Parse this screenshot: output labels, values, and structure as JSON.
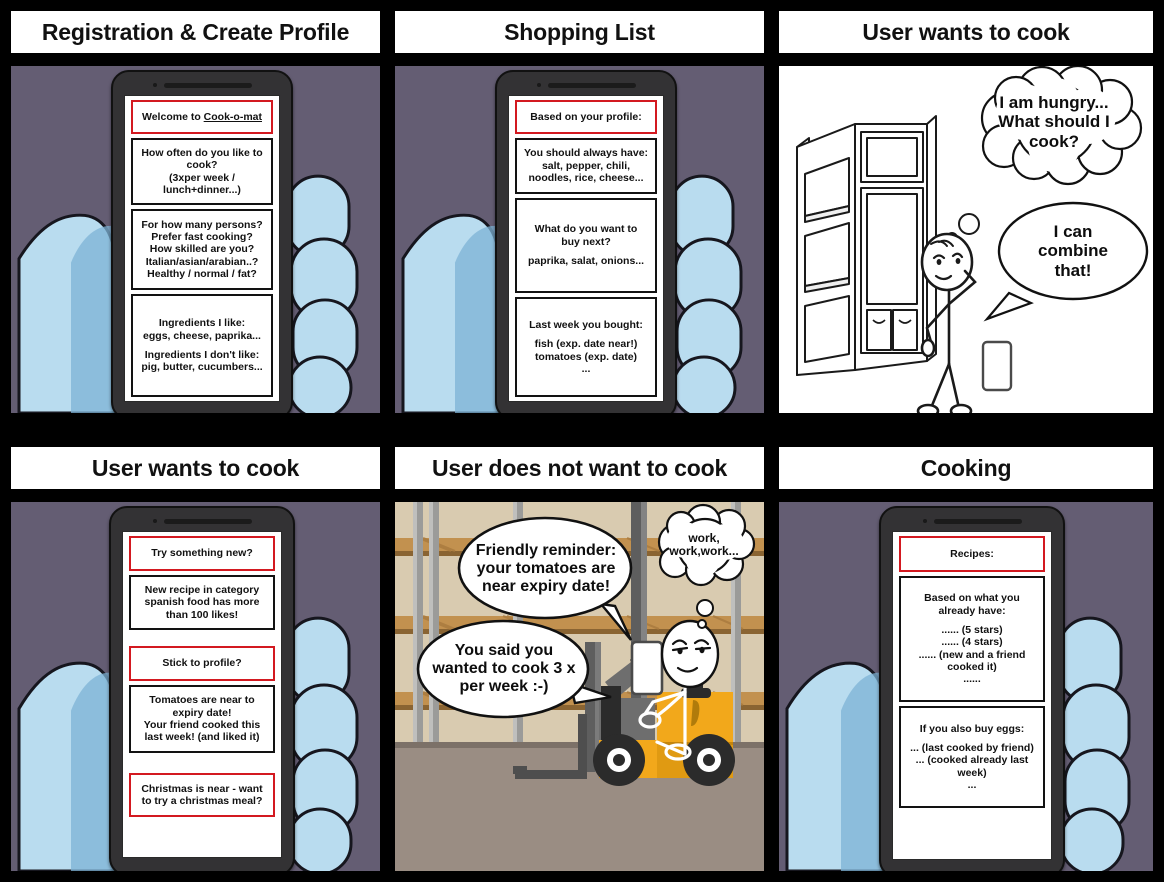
{
  "meta": {
    "kind": "storyboard",
    "rows": 2,
    "cols": 3,
    "background": "#000000"
  },
  "palette": {
    "panel_border": "#000000",
    "title_bg": "#ffffff",
    "scene_purple": "#645d73",
    "hand_light": "#b9dcef",
    "hand_mid": "#7eb3d6",
    "hand_outline": "#16161e",
    "phone_body": "#333234",
    "screen": "#ffffff",
    "card_border": "#121212",
    "card_border_highlight": "#d31920",
    "warehouse_wall": "#d9cbb0",
    "warehouse_shelf": "#c2914f",
    "warehouse_post": "#9b9b99",
    "warehouse_floor": "#9a8d83",
    "forklift_yellow": "#f2a81b",
    "forklift_dark": "#5e5e5e",
    "ink": "#111111"
  },
  "panels": [
    {
      "id": "registration",
      "title": "Registration & Create Profile",
      "scene": "phone-purple",
      "phone_cards": [
        {
          "highlight": true,
          "lines": [
            {
              "text": "Welcome to ",
              "underline": false,
              "inline": true
            },
            {
              "text": "Cook-o-mat",
              "underline": true,
              "inline": true
            }
          ]
        },
        {
          "highlight": false,
          "lines": [
            {
              "text": "How often do you like to"
            },
            {
              "text": "cook?"
            },
            {
              "text": "(3xper week /"
            },
            {
              "text": "lunch+dinner...)"
            }
          ]
        },
        {
          "highlight": false,
          "lines": [
            {
              "text": "For how many persons?"
            },
            {
              "text": "Prefer fast cooking?"
            },
            {
              "text": "How skilled are you?"
            },
            {
              "text": "Italian/asian/arabian..?"
            },
            {
              "text": "Healthy / normal / fat?"
            }
          ]
        },
        {
          "highlight": false,
          "lines": [
            {
              "text": "Ingredients I like:"
            },
            {
              "text": "eggs, cheese, paprika..."
            },
            {
              "spacer": true
            },
            {
              "text": "Ingredients I don't like:"
            },
            {
              "text": "pig, butter, cucumbers..."
            }
          ]
        }
      ]
    },
    {
      "id": "shopping-list",
      "title": "Shopping List",
      "scene": "phone-purple",
      "phone_cards": [
        {
          "highlight": true,
          "lines": [
            {
              "text": "Based on your profile:"
            }
          ]
        },
        {
          "highlight": false,
          "lines": [
            {
              "text": "You should always have:"
            },
            {
              "text": "salt, pepper, chili,"
            },
            {
              "text": "noodles, rice, cheese..."
            }
          ]
        },
        {
          "highlight": false,
          "lines": [
            {
              "text": "What do you want to"
            },
            {
              "text": "buy next?"
            },
            {
              "spacer": true
            },
            {
              "text": "paprika, salat, onions..."
            }
          ]
        },
        {
          "highlight": false,
          "lines": [
            {
              "text": "Last week you bought:"
            },
            {
              "spacer": true
            },
            {
              "text": "fish (exp. date near!)"
            },
            {
              "text": "tomatoes (exp. date)"
            },
            {
              "text": "..."
            }
          ]
        }
      ]
    },
    {
      "id": "user-wants-to-cook-fridge",
      "title": "User wants to cook",
      "scene": "fridge-white",
      "balloons": [
        {
          "id": "thought-hungry",
          "shape": "thought",
          "lines": [
            "I am hungry...",
            "What should I",
            "cook?"
          ],
          "font_size": 17
        },
        {
          "id": "speech-combine",
          "shape": "speech-oval",
          "lines": [
            "I can",
            "combine",
            "that!"
          ],
          "font_size": 17
        }
      ],
      "props": [
        "fridge-open",
        "stick-figure-thinking",
        "smartphone"
      ]
    },
    {
      "id": "user-wants-to-cook-phone",
      "title": "User wants to cook",
      "scene": "phone-purple",
      "phone_cards": [
        {
          "highlight": true,
          "lines": [
            {
              "text": "Try something new?"
            }
          ]
        },
        {
          "highlight": false,
          "lines": [
            {
              "text": "New recipe in category"
            },
            {
              "text": "spanish food has more"
            },
            {
              "text": "than 100 likes!"
            }
          ]
        },
        {
          "highlight": true,
          "lines": [
            {
              "text": "Stick to profile?"
            }
          ]
        },
        {
          "highlight": false,
          "lines": [
            {
              "text": "Tomatoes are near to"
            },
            {
              "text": "expiry date!"
            },
            {
              "text": "Your friend cooked this"
            },
            {
              "text": "last week! (and liked it)"
            }
          ]
        },
        {
          "highlight": true,
          "lines": [
            {
              "text": "Christmas is near - want"
            },
            {
              "text": "to try a christmas meal?"
            }
          ]
        }
      ]
    },
    {
      "id": "user-does-not-want-to-cook",
      "title": "User does not want to cook",
      "scene": "warehouse",
      "balloons": [
        {
          "id": "speech-reminder",
          "shape": "speech-oval",
          "lines": [
            "Friendly reminder:",
            "your tomatoes are",
            "near expiry date!"
          ],
          "font_size": 16
        },
        {
          "id": "speech-3x-week",
          "shape": "speech-oval",
          "lines": [
            "You said you",
            "wanted to cook 3 x",
            "per week :-)"
          ],
          "font_size": 16
        },
        {
          "id": "thought-work",
          "shape": "thought",
          "lines": [
            "work,",
            "work,work..."
          ],
          "font_size": 12
        }
      ],
      "props": [
        "warehouse-racks",
        "forklift",
        "stick-figure-driver",
        "smartphone"
      ]
    },
    {
      "id": "cooking",
      "title": "Cooking",
      "scene": "phone-purple",
      "phone_cards": [
        {
          "highlight": true,
          "lines": [
            {
              "text": "Recipes:"
            }
          ]
        },
        {
          "highlight": false,
          "lines": [
            {
              "text": "Based on what you"
            },
            {
              "text": "already have:"
            },
            {
              "spacer": true
            },
            {
              "text": "...... (5 stars)"
            },
            {
              "text": "...... (4 stars)"
            },
            {
              "text": "...... (new and a friend"
            },
            {
              "text": "cooked it)"
            },
            {
              "text": "......"
            }
          ]
        },
        {
          "highlight": false,
          "lines": [
            {
              "text": "If you also buy eggs:"
            },
            {
              "spacer": true
            },
            {
              "text": "... (last cooked by friend)"
            },
            {
              "text": "... (cooked already last"
            },
            {
              "text": "week)"
            },
            {
              "text": "..."
            }
          ]
        }
      ]
    }
  ]
}
